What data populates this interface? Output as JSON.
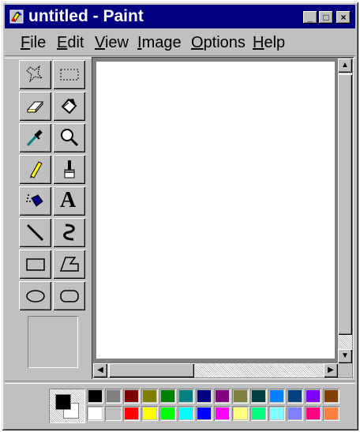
{
  "window": {
    "title": "untitled - Paint",
    "controls": {
      "minimize": "_",
      "maximize": "□",
      "close": "×"
    }
  },
  "menu": [
    {
      "label": "File",
      "mnemonic": "F",
      "rest": "ile"
    },
    {
      "label": "Edit",
      "mnemonic": "E",
      "rest": "dit"
    },
    {
      "label": "View",
      "mnemonic": "V",
      "rest": "iew"
    },
    {
      "label": "Image",
      "mnemonic": "I",
      "rest": "mage"
    },
    {
      "label": "Options",
      "mnemonic": "O",
      "rest": "ptions"
    },
    {
      "label": "Help",
      "mnemonic": "H",
      "rest": "elp"
    }
  ],
  "tools": [
    {
      "name": "free-form-select-icon"
    },
    {
      "name": "rectangle-select-icon"
    },
    {
      "name": "eraser-icon"
    },
    {
      "name": "fill-bucket-icon"
    },
    {
      "name": "color-picker-icon"
    },
    {
      "name": "magnifier-icon"
    },
    {
      "name": "pencil-icon"
    },
    {
      "name": "brush-icon"
    },
    {
      "name": "airbrush-icon"
    },
    {
      "name": "text-icon",
      "glyph": "A"
    },
    {
      "name": "line-icon"
    },
    {
      "name": "curve-icon"
    },
    {
      "name": "rectangle-icon"
    },
    {
      "name": "polygon-icon"
    },
    {
      "name": "ellipse-icon"
    },
    {
      "name": "rounded-rectangle-icon"
    }
  ],
  "current_colors": {
    "foreground": "#000000",
    "background": "#ffffff"
  },
  "palette": {
    "row1": [
      "#000000",
      "#808080",
      "#800000",
      "#808000",
      "#008000",
      "#008080",
      "#000080",
      "#800080",
      "#808040",
      "#004040",
      "#0080ff",
      "#004080",
      "#8000ff",
      "#804000"
    ],
    "row2": [
      "#ffffff",
      "#c0c0c0",
      "#ff0000",
      "#ffff00",
      "#00ff00",
      "#00ffff",
      "#0000ff",
      "#ff00ff",
      "#ffff80",
      "#00ff80",
      "#80ffff",
      "#8080ff",
      "#ff0080",
      "#ff8040"
    ]
  }
}
